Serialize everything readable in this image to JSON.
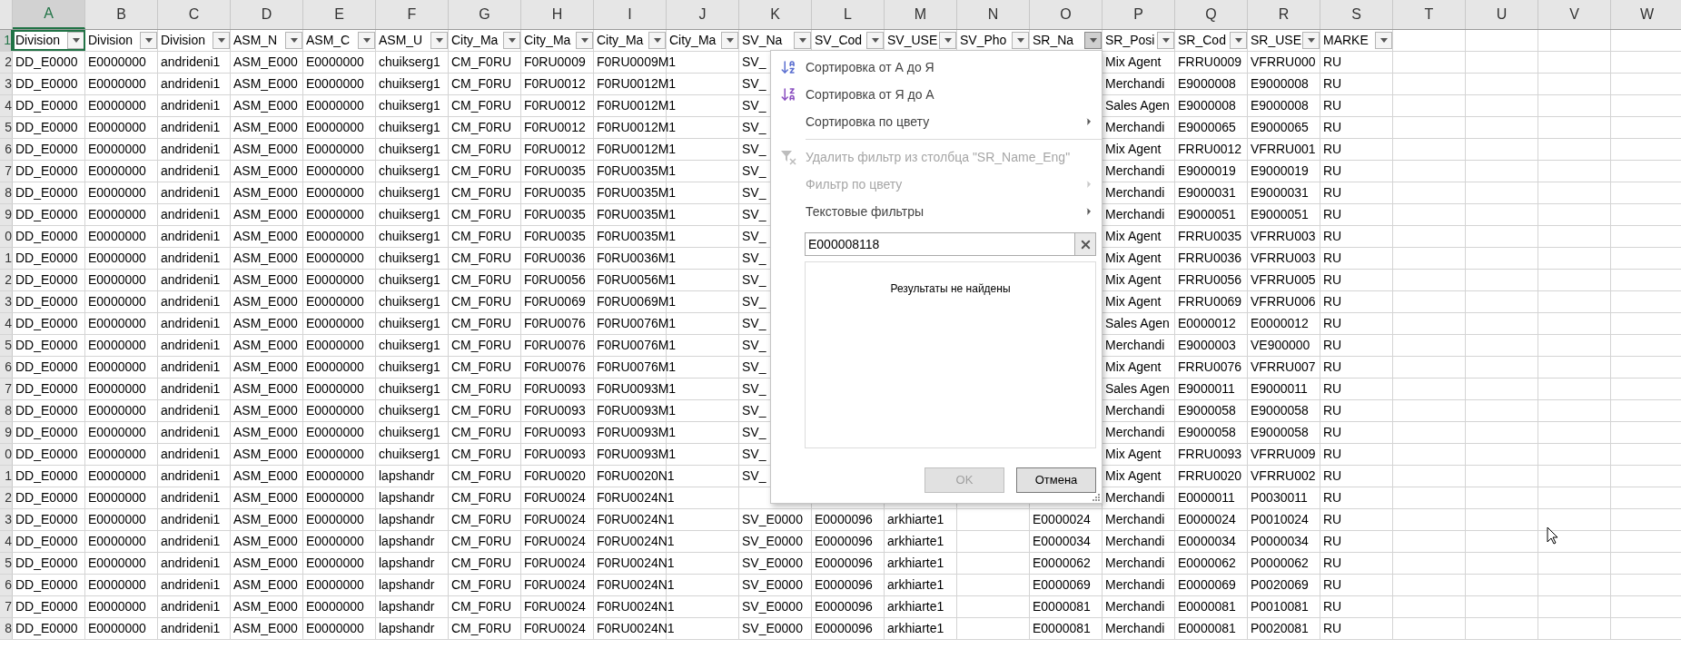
{
  "column_headers": [
    {
      "label": "A",
      "selected": true
    },
    {
      "label": "B",
      "selected": false
    },
    {
      "label": "C",
      "selected": false
    },
    {
      "label": "D",
      "selected": false
    },
    {
      "label": "E",
      "selected": false
    },
    {
      "label": "F",
      "selected": false
    },
    {
      "label": "G",
      "selected": false
    },
    {
      "label": "H",
      "selected": false
    },
    {
      "label": "I",
      "selected": false
    },
    {
      "label": "J",
      "selected": false
    },
    {
      "label": "K",
      "selected": false
    },
    {
      "label": "L",
      "selected": false
    },
    {
      "label": "M",
      "selected": false
    },
    {
      "label": "N",
      "selected": false
    },
    {
      "label": "O",
      "selected": false
    },
    {
      "label": "P",
      "selected": false
    },
    {
      "label": "Q",
      "selected": false
    },
    {
      "label": "R",
      "selected": false
    },
    {
      "label": "S",
      "selected": false
    },
    {
      "label": "T",
      "selected": false
    },
    {
      "label": "U",
      "selected": false
    },
    {
      "label": "V",
      "selected": false
    },
    {
      "label": "W",
      "selected": false
    }
  ],
  "header_row": {
    "row_number": "1",
    "cells": [
      {
        "text": "Division",
        "filter_open": false
      },
      {
        "text": "Division",
        "filter_open": false
      },
      {
        "text": "Division",
        "filter_open": false
      },
      {
        "text": "ASM_N",
        "filter_open": false
      },
      {
        "text": "ASM_C",
        "filter_open": false
      },
      {
        "text": "ASM_U",
        "filter_open": false
      },
      {
        "text": "City_Ma",
        "filter_open": false
      },
      {
        "text": "City_Ma",
        "filter_open": false
      },
      {
        "text": "City_Ma",
        "filter_open": false
      },
      {
        "text": "City_Ma",
        "filter_open": false
      },
      {
        "text": "SV_Na",
        "filter_open": false
      },
      {
        "text": "SV_Cod",
        "filter_open": false
      },
      {
        "text": "SV_USE",
        "filter_open": false
      },
      {
        "text": "SV_Pho",
        "filter_open": false
      },
      {
        "text": "SR_Na",
        "filter_open": true
      },
      {
        "text": "SR_Posi",
        "filter_open": false
      },
      {
        "text": "SR_Cod",
        "filter_open": false
      },
      {
        "text": "SR_USE",
        "filter_open": false
      },
      {
        "text": "MARKE",
        "filter_open": false
      }
    ]
  },
  "rows": [
    {
      "row_number": "2",
      "cells": [
        "DD_E0000",
        "E0000000",
        "andrideni1",
        "ASM_E000",
        "E0000000",
        "chuikserg1",
        "CM_F0RU",
        "F0RU0009",
        "F0RU0009M1",
        null,
        "SV_",
        null,
        null,
        null,
        null,
        "Mix Agent",
        "FRRU0009",
        "VFRRU000",
        "RU"
      ]
    },
    {
      "row_number": "3",
      "cells": [
        "DD_E0000",
        "E0000000",
        "andrideni1",
        "ASM_E000",
        "E0000000",
        "chuikserg1",
        "CM_F0RU",
        "F0RU0012",
        "F0RU0012M1",
        null,
        "SV_",
        null,
        null,
        null,
        null,
        "Merchandi",
        "E9000008",
        "E9000008",
        "RU"
      ]
    },
    {
      "row_number": "4",
      "cells": [
        "DD_E0000",
        "E0000000",
        "andrideni1",
        "ASM_E000",
        "E0000000",
        "chuikserg1",
        "CM_F0RU",
        "F0RU0012",
        "F0RU0012M1",
        null,
        "SV_",
        null,
        null,
        null,
        null,
        "Sales Agen",
        "E9000008",
        "E9000008",
        "RU"
      ]
    },
    {
      "row_number": "5",
      "cells": [
        "DD_E0000",
        "E0000000",
        "andrideni1",
        "ASM_E000",
        "E0000000",
        "chuikserg1",
        "CM_F0RU",
        "F0RU0012",
        "F0RU0012M1",
        null,
        "SV_",
        null,
        null,
        null,
        null,
        "Merchandi",
        "E9000065",
        "E9000065",
        "RU"
      ]
    },
    {
      "row_number": "6",
      "cells": [
        "DD_E0000",
        "E0000000",
        "andrideni1",
        "ASM_E000",
        "E0000000",
        "chuikserg1",
        "CM_F0RU",
        "F0RU0012",
        "F0RU0012M1",
        null,
        "SV_",
        null,
        null,
        null,
        null,
        "Mix Agent",
        "FRRU0012",
        "VFRRU001",
        "RU"
      ]
    },
    {
      "row_number": "7",
      "cells": [
        "DD_E0000",
        "E0000000",
        "andrideni1",
        "ASM_E000",
        "E0000000",
        "chuikserg1",
        "CM_F0RU",
        "F0RU0035",
        "F0RU0035M1",
        null,
        "SV_",
        null,
        null,
        null,
        null,
        "Merchandi",
        "E9000019",
        "E9000019",
        "RU"
      ]
    },
    {
      "row_number": "8",
      "cells": [
        "DD_E0000",
        "E0000000",
        "andrideni1",
        "ASM_E000",
        "E0000000",
        "chuikserg1",
        "CM_F0RU",
        "F0RU0035",
        "F0RU0035M1",
        null,
        "SV_",
        null,
        null,
        null,
        null,
        "Merchandi",
        "E9000031",
        "E9000031",
        "RU"
      ]
    },
    {
      "row_number": "9",
      "cells": [
        "DD_E0000",
        "E0000000",
        "andrideni1",
        "ASM_E000",
        "E0000000",
        "chuikserg1",
        "CM_F0RU",
        "F0RU0035",
        "F0RU0035M1",
        null,
        "SV_",
        null,
        null,
        null,
        null,
        "Merchandi",
        "E9000051",
        "E9000051",
        "RU"
      ]
    },
    {
      "row_number": "0",
      "cells": [
        "DD_E0000",
        "E0000000",
        "andrideni1",
        "ASM_E000",
        "E0000000",
        "chuikserg1",
        "CM_F0RU",
        "F0RU0035",
        "F0RU0035M1",
        null,
        "SV_",
        null,
        null,
        null,
        null,
        "Mix Agent",
        "FRRU0035",
        "VFRRU003",
        "RU"
      ]
    },
    {
      "row_number": "1",
      "cells": [
        "DD_E0000",
        "E0000000",
        "andrideni1",
        "ASM_E000",
        "E0000000",
        "chuikserg1",
        "CM_F0RU",
        "F0RU0036",
        "F0RU0036M1",
        null,
        "SV_",
        null,
        null,
        null,
        null,
        "Mix Agent",
        "FRRU0036",
        "VFRRU003",
        "RU"
      ]
    },
    {
      "row_number": "2",
      "cells": [
        "DD_E0000",
        "E0000000",
        "andrideni1",
        "ASM_E000",
        "E0000000",
        "chuikserg1",
        "CM_F0RU",
        "F0RU0056",
        "F0RU0056M1",
        null,
        "SV_",
        null,
        null,
        null,
        null,
        "Mix Agent",
        "FRRU0056",
        "VFRRU005",
        "RU"
      ]
    },
    {
      "row_number": "3",
      "cells": [
        "DD_E0000",
        "E0000000",
        "andrideni1",
        "ASM_E000",
        "E0000000",
        "chuikserg1",
        "CM_F0RU",
        "F0RU0069",
        "F0RU0069M1",
        null,
        "SV_",
        null,
        null,
        null,
        null,
        "Mix Agent",
        "FRRU0069",
        "VFRRU006",
        "RU"
      ]
    },
    {
      "row_number": "4",
      "cells": [
        "DD_E0000",
        "E0000000",
        "andrideni1",
        "ASM_E000",
        "E0000000",
        "chuikserg1",
        "CM_F0RU",
        "F0RU0076",
        "F0RU0076M1",
        null,
        "SV_",
        null,
        null,
        null,
        null,
        "Sales Agen",
        "E0000012",
        "E0000012",
        "RU"
      ]
    },
    {
      "row_number": "5",
      "cells": [
        "DD_E0000",
        "E0000000",
        "andrideni1",
        "ASM_E000",
        "E0000000",
        "chuikserg1",
        "CM_F0RU",
        "F0RU0076",
        "F0RU0076M1",
        null,
        "SV_",
        null,
        null,
        null,
        null,
        "Merchandi",
        "E9000003",
        "VE900000",
        "RU"
      ]
    },
    {
      "row_number": "6",
      "cells": [
        "DD_E0000",
        "E0000000",
        "andrideni1",
        "ASM_E000",
        "E0000000",
        "chuikserg1",
        "CM_F0RU",
        "F0RU0076",
        "F0RU0076M1",
        null,
        "SV_",
        null,
        null,
        null,
        null,
        "Mix Agent",
        "FRRU0076",
        "VFRRU007",
        "RU"
      ]
    },
    {
      "row_number": "7",
      "cells": [
        "DD_E0000",
        "E0000000",
        "andrideni1",
        "ASM_E000",
        "E0000000",
        "chuikserg1",
        "CM_F0RU",
        "F0RU0093",
        "F0RU0093M1",
        null,
        "SV_",
        null,
        null,
        null,
        null,
        "Sales Agen",
        "E9000011",
        "E9000011",
        "RU"
      ]
    },
    {
      "row_number": "8",
      "cells": [
        "DD_E0000",
        "E0000000",
        "andrideni1",
        "ASM_E000",
        "E0000000",
        "chuikserg1",
        "CM_F0RU",
        "F0RU0093",
        "F0RU0093M1",
        null,
        "SV_",
        null,
        null,
        null,
        null,
        "Merchandi",
        "E9000058",
        "E9000058",
        "RU"
      ]
    },
    {
      "row_number": "9",
      "cells": [
        "DD_E0000",
        "E0000000",
        "andrideni1",
        "ASM_E000",
        "E0000000",
        "chuikserg1",
        "CM_F0RU",
        "F0RU0093",
        "F0RU0093M1",
        null,
        "SV_",
        null,
        null,
        null,
        null,
        "Merchandi",
        "E9000058",
        "E9000058",
        "RU"
      ]
    },
    {
      "row_number": "0",
      "cells": [
        "DD_E0000",
        "E0000000",
        "andrideni1",
        "ASM_E000",
        "E0000000",
        "chuikserg1",
        "CM_F0RU",
        "F0RU0093",
        "F0RU0093M1",
        null,
        "SV_",
        null,
        null,
        null,
        null,
        "Mix Agent",
        "FRRU0093",
        "VFRRU009",
        "RU"
      ]
    },
    {
      "row_number": "1",
      "cells": [
        "DD_E0000",
        "E0000000",
        "andrideni1",
        "ASM_E000",
        "E0000000",
        "lapshandr",
        "CM_F0RU",
        "F0RU0020",
        "F0RU0020N1",
        null,
        "SV_",
        null,
        null,
        null,
        null,
        "Mix Agent",
        "FRRU0020",
        "VFRRU002",
        "RU"
      ]
    },
    {
      "row_number": "2",
      "cells": [
        "DD_E0000",
        "E0000000",
        "andrideni1",
        "ASM_E000",
        "E0000000",
        "lapshandr",
        "CM_F0RU",
        "F0RU0024",
        "F0RU0024N1",
        null,
        null,
        null,
        null,
        null,
        null,
        "Merchandi",
        "E0000011",
        "P0030011",
        "RU"
      ]
    },
    {
      "row_number": "3",
      "cells": [
        "DD_E0000",
        "E0000000",
        "andrideni1",
        "ASM_E000",
        "E0000000",
        "lapshandr",
        "CM_F0RU",
        "F0RU0024",
        "F0RU0024N1",
        null,
        "SV_E0000",
        "E0000096",
        "arkhiarte1",
        null,
        "E0000024",
        "Merchandi",
        "E0000024",
        "P0010024",
        "RU"
      ]
    },
    {
      "row_number": "4",
      "cells": [
        "DD_E0000",
        "E0000000",
        "andrideni1",
        "ASM_E000",
        "E0000000",
        "lapshandr",
        "CM_F0RU",
        "F0RU0024",
        "F0RU0024N1",
        null,
        "SV_E0000",
        "E0000096",
        "arkhiarte1",
        null,
        "E0000034",
        "Merchandi",
        "E0000034",
        "P0000034",
        "RU"
      ]
    },
    {
      "row_number": "5",
      "cells": [
        "DD_E0000",
        "E0000000",
        "andrideni1",
        "ASM_E000",
        "E0000000",
        "lapshandr",
        "CM_F0RU",
        "F0RU0024",
        "F0RU0024N1",
        null,
        "SV_E0000",
        "E0000096",
        "arkhiarte1",
        null,
        "E0000062",
        "Merchandi",
        "E0000062",
        "P0000062",
        "RU"
      ]
    },
    {
      "row_number": "6",
      "cells": [
        "DD_E0000",
        "E0000000",
        "andrideni1",
        "ASM_E000",
        "E0000000",
        "lapshandr",
        "CM_F0RU",
        "F0RU0024",
        "F0RU0024N1",
        null,
        "SV_E0000",
        "E0000096",
        "arkhiarte1",
        null,
        "E0000069",
        "Merchandi",
        "E0000069",
        "P0020069",
        "RU"
      ]
    },
    {
      "row_number": "7",
      "cells": [
        "DD_E0000",
        "E0000000",
        "andrideni1",
        "ASM_E000",
        "E0000000",
        "lapshandr",
        "CM_F0RU",
        "F0RU0024",
        "F0RU0024N1",
        null,
        "SV_E0000",
        "E0000096",
        "arkhiarte1",
        null,
        "E0000081",
        "Merchandi",
        "E0000081",
        "P0010081",
        "RU"
      ]
    },
    {
      "row_number": "8",
      "cells": [
        "DD_E0000",
        "E0000000",
        "andrideni1",
        "ASM_E000",
        "E0000000",
        "lapshandr",
        "CM_F0RU",
        "F0RU0024",
        "F0RU0024N1",
        null,
        "SV_E0000",
        "E0000096",
        "arkhiarte1",
        null,
        "E0000081",
        "Merchandi",
        "E0000081",
        "P0020081",
        "RU"
      ]
    }
  ],
  "filter_menu": {
    "items": [
      {
        "kind": "sort_asc",
        "label": "Сортировка от А до Я",
        "disabled": false,
        "submenu": false
      },
      {
        "kind": "sort_desc",
        "label": "Сортировка от Я до А",
        "disabled": false,
        "submenu": false
      },
      {
        "kind": "plain",
        "label": "Сортировка по цвету",
        "disabled": false,
        "submenu": true
      },
      {
        "kind": "separator"
      },
      {
        "kind": "clear_filter",
        "label": "Удалить фильтр из столбца \"SR_Name_Eng\"",
        "disabled": true,
        "submenu": false
      },
      {
        "kind": "plain",
        "label": "Фильтр по цвету",
        "disabled": true,
        "submenu": true
      },
      {
        "kind": "plain",
        "label": "Текстовые фильтры",
        "disabled": false,
        "submenu": true
      }
    ],
    "search_value": "E000008118",
    "results_message": "Результаты не найдены",
    "ok_button": {
      "label": "OK",
      "disabled": true
    },
    "cancel_button": {
      "label": "Отмена",
      "disabled": false
    }
  }
}
